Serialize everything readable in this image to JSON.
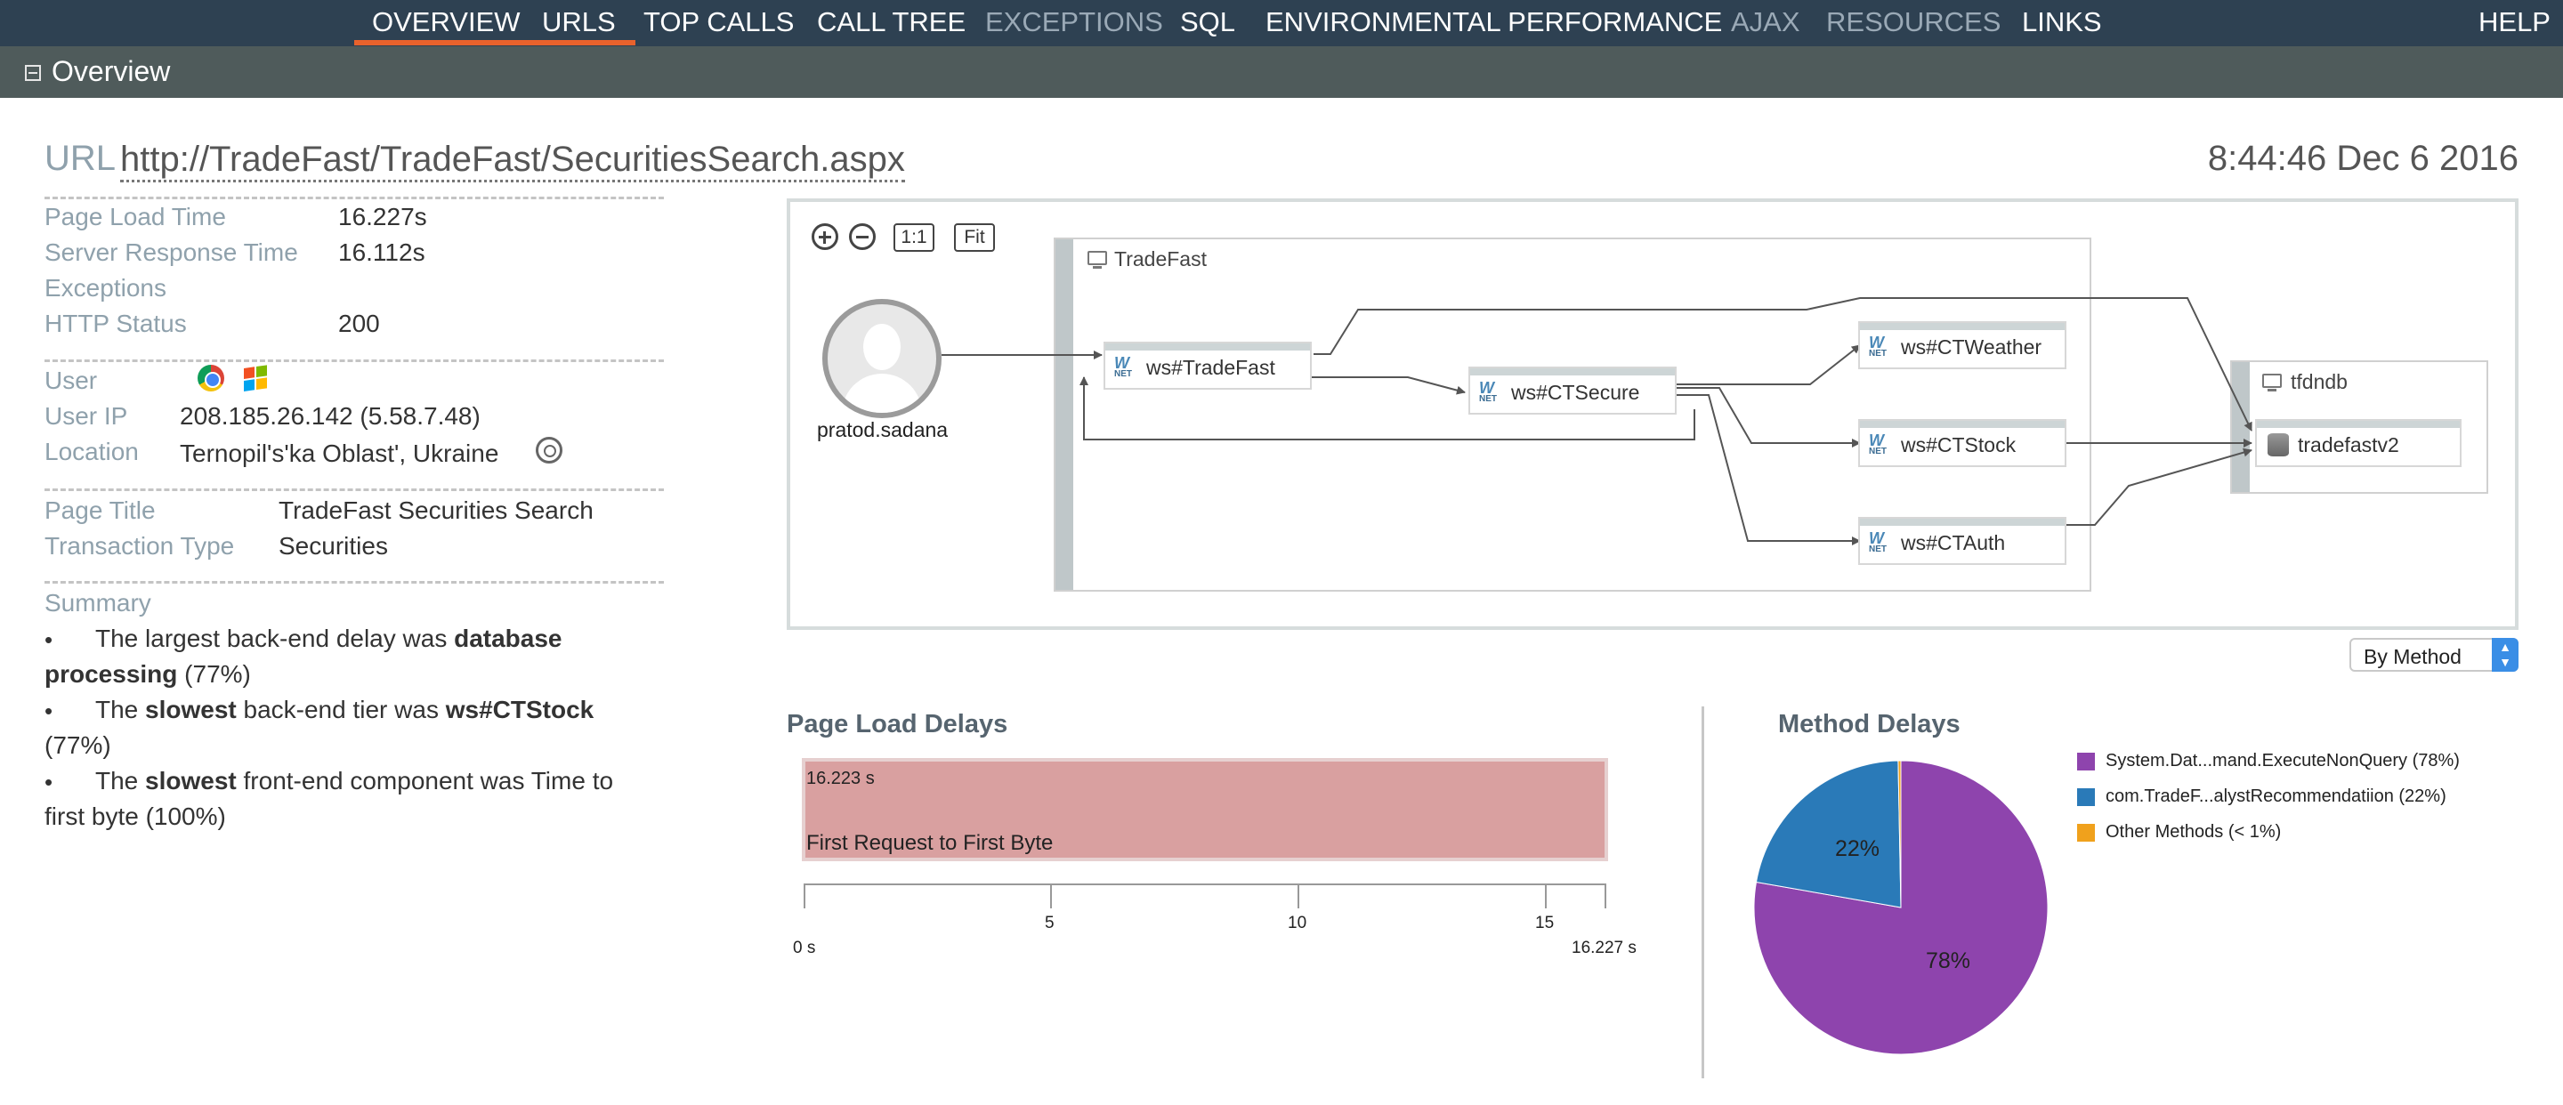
{
  "nav": {
    "items": [
      {
        "label": "OVERVIEW"
      },
      {
        "label": "URLS"
      },
      {
        "label": "TOP CALLS"
      },
      {
        "label": "CALL TREE"
      },
      {
        "label": "EXCEPTIONS"
      },
      {
        "label": "SQL"
      },
      {
        "label": "ENVIRONMENTAL PERFORMANCE"
      },
      {
        "label": "AJAX"
      },
      {
        "label": "RESOURCES"
      },
      {
        "label": "LINKS"
      }
    ],
    "help": "HELP",
    "active": "OVERVIEW"
  },
  "section": {
    "title": "Overview"
  },
  "header": {
    "url_label": "URL",
    "url": "http://TradeFast/TradeFast/SecuritiesSearch.aspx",
    "timestamp": "8:44:46 Dec 6 2016"
  },
  "details": {
    "page_load_time_label": "Page Load Time",
    "page_load_time": "16.227s",
    "server_response_time_label": "Server Response Time",
    "server_response_time": "16.112s",
    "exceptions_label": "Exceptions",
    "http_status_label": "HTTP Status",
    "http_status": "200",
    "user_label": "User",
    "user_ip_label": "User IP",
    "user_ip": "208.185.26.142 (5.58.7.48)",
    "location_label": "Location",
    "location": "Ternopil's'ka Oblast', Ukraine",
    "page_title_label": "Page Title",
    "page_title": "TradeFast Securities Search",
    "transaction_type_label": "Transaction Type",
    "transaction_type": "Securities"
  },
  "summary": {
    "label": "Summary",
    "items": [
      {
        "a": "The largest back-end delay was ",
        "b": "database",
        "c": "processing",
        "d": " (77%)"
      },
      {
        "a": "The ",
        "b": "slowest",
        "c": " back-end tier was ",
        "d": "ws#CTStock",
        "e": "(77%)"
      },
      {
        "a": "The ",
        "b": "slowest",
        "c": " front-end component was Time to",
        "d": "first byte (100%)"
      }
    ]
  },
  "topology": {
    "controls": {
      "fit_label": "Fit",
      "one_to_one_label": "1:1"
    },
    "user": "pratod.sadana",
    "group_tradefast": "TradeFast",
    "group_db": "tfdndb",
    "nodes": {
      "ws_tradefast": "ws#TradeFast",
      "ws_ctsecure": "ws#CTSecure",
      "ws_ctweather": "ws#CTWeather",
      "ws_ctstock": "ws#CTStock",
      "ws_ctauth": "ws#CTAuth",
      "db": "tradefastv2"
    },
    "net_icon_text": "NET"
  },
  "view_select": {
    "value": "By Method"
  },
  "page_load_delays": {
    "title": "Page Load Delays",
    "bar_value": "16.223 s",
    "bar_label": "First Request to First Byte",
    "axis": {
      "min_label": "0 s",
      "max_label": "16.227 s",
      "ticks": [
        "5",
        "10",
        "15"
      ]
    },
    "chart_data": {
      "type": "bar",
      "categories": [
        "First Request to First Byte"
      ],
      "values": [
        16.223
      ],
      "xlim": [
        0,
        16.227
      ]
    }
  },
  "method_delays": {
    "title": "Method Delays",
    "legend": [
      {
        "label": "System.Dat...mand.ExecuteNonQuery (78%)",
        "color": "#8e44ad"
      },
      {
        "label": "com.TradeF...alystRecommendatiion (22%)",
        "color": "#2a7ab8"
      },
      {
        "label": "Other Methods (< 1%)",
        "color": "#f0a11c"
      }
    ],
    "slice_labels": [
      "78%",
      "22%"
    ],
    "chart_data": {
      "type": "pie",
      "categories": [
        "System.Dat...mand.ExecuteNonQuery",
        "com.TradeF...alystRecommendatiion",
        "Other Methods"
      ],
      "values": [
        78,
        22,
        0.3
      ]
    }
  },
  "colors": {
    "nav_bg": "#2e4152",
    "nav_active_underline": "#e8622c",
    "section_bar": "#4f5b5b",
    "bar_fill": "#d9a0a0"
  }
}
